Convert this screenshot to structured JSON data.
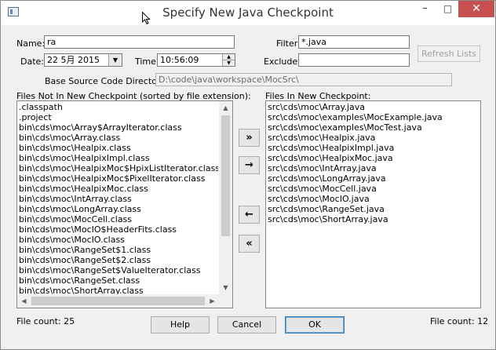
{
  "window": {
    "title": "Specify New Java Checkpoint",
    "minimize_glyph": "–",
    "maximize_glyph": "□",
    "close_glyph": "✕"
  },
  "form": {
    "name_label": "Name:",
    "name_value": "ra",
    "filter_label": "Filter:",
    "filter_value": "*.java",
    "date_label": "Date:",
    "date_value": "22  5月  2015",
    "time_label": "Time:",
    "time_value": "10:56:09",
    "exclude_label": "Exclude:",
    "exclude_value": "",
    "refresh_label": "Refresh Lists",
    "base_dir_label": "Base Source Code Directory:",
    "base_dir_value": "D:\\code\\java\\workspace\\MocSrc\\"
  },
  "left_list": {
    "header": "Files Not In New Checkpoint (sorted by file extension):",
    "items": [
      ".classpath",
      ".project",
      "bin\\cds\\moc\\Array$ArrayIterator.class",
      "bin\\cds\\moc\\Array.class",
      "bin\\cds\\moc\\Healpix.class",
      "bin\\cds\\moc\\HealpixImpl.class",
      "bin\\cds\\moc\\HealpixMoc$HpixListIterator.class",
      "bin\\cds\\moc\\HealpixMoc$PixelIterator.class",
      "bin\\cds\\moc\\HealpixMoc.class",
      "bin\\cds\\moc\\IntArray.class",
      "bin\\cds\\moc\\LongArray.class",
      "bin\\cds\\moc\\MocCell.class",
      "bin\\cds\\moc\\MocIO$HeaderFits.class",
      "bin\\cds\\moc\\MocIO.class",
      "bin\\cds\\moc\\RangeSet$1.class",
      "bin\\cds\\moc\\RangeSet$2.class",
      "bin\\cds\\moc\\RangeSet$ValueIterator.class",
      "bin\\cds\\moc\\RangeSet.class",
      "bin\\cds\\moc\\ShortArray.class"
    ],
    "file_count": "File count: 25"
  },
  "right_list": {
    "header": "Files In New Checkpoint:",
    "items": [
      "src\\cds\\moc\\Array.java",
      "src\\cds\\moc\\examples\\MocExample.java",
      "src\\cds\\moc\\examples\\MocTest.java",
      "src\\cds\\moc\\Healpix.java",
      "src\\cds\\moc\\HealpixImpl.java",
      "src\\cds\\moc\\HealpixMoc.java",
      "src\\cds\\moc\\IntArray.java",
      "src\\cds\\moc\\LongArray.java",
      "src\\cds\\moc\\MocCell.java",
      "src\\cds\\moc\\MocIO.java",
      "src\\cds\\moc\\RangeSet.java",
      "src\\cds\\moc\\ShortArray.java"
    ],
    "file_count": "File count: 12"
  },
  "move_buttons": {
    "add_all": "»",
    "add_one": "→",
    "remove_one": "←",
    "remove_all": "«"
  },
  "footer": {
    "help": "Help",
    "cancel": "Cancel",
    "ok": "OK"
  }
}
